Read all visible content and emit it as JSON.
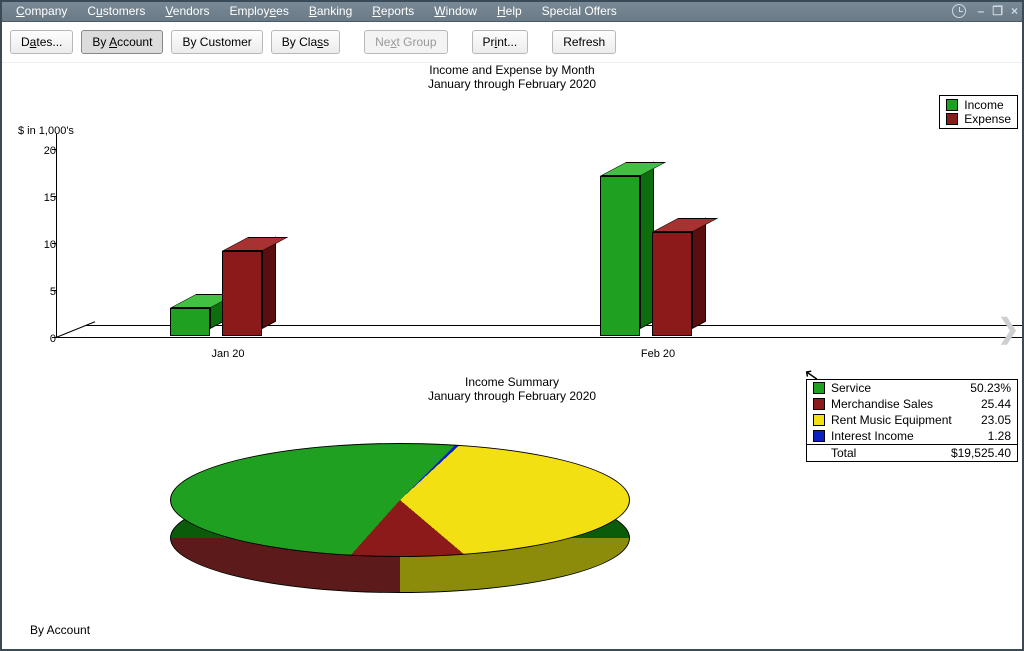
{
  "menu": {
    "items": [
      "Company",
      "Customers",
      "Vendors",
      "Employees",
      "Banking",
      "Reports",
      "Window",
      "Help",
      "Special Offers"
    ]
  },
  "window_controls": {
    "minimize": "–",
    "restore": "❐",
    "close": "×"
  },
  "toolbar": {
    "dates": "Dates...",
    "by_account": "By Account",
    "by_customer": "By Customer",
    "by_class": "By Class",
    "next_group": "Next Group",
    "print": "Print...",
    "refresh": "Refresh"
  },
  "bar_chart": {
    "title": "Income and Expense by Month",
    "subtitle": "January through February 2020",
    "axis_label": "$ in 1,000's",
    "legend": {
      "income": "Income",
      "expense": "Expense"
    },
    "y_ticks": [
      "0",
      "5",
      "10",
      "15",
      "20"
    ],
    "x_ticks": [
      "Jan 20",
      "Feb 20"
    ]
  },
  "pie": {
    "title": "Income Summary",
    "subtitle": "January through February 2020",
    "legend": [
      {
        "label": "Service",
        "value": "50.23%",
        "color": "#20a020"
      },
      {
        "label": "Merchandise Sales",
        "value": "25.44",
        "color": "#8c1a1a"
      },
      {
        "label": "Rent Music Equipment",
        "value": "23.05",
        "color": "#f2e012"
      },
      {
        "label": "Interest Income",
        "value": "1.28",
        "color": "#0a20c0"
      }
    ],
    "total_label": "Total",
    "total_value": "$19,525.40"
  },
  "footer": {
    "view_label": "By Account"
  },
  "chart_data": [
    {
      "type": "bar",
      "title": "Income and Expense by Month",
      "subtitle": "January through February 2020",
      "categories": [
        "Jan 20",
        "Feb 20"
      ],
      "series": [
        {
          "name": "Income",
          "values": [
            3,
            17
          ],
          "color": "#20a020"
        },
        {
          "name": "Expense",
          "values": [
            9,
            11
          ],
          "color": "#8c1a1a"
        }
      ],
      "ylabel": "$ in 1,000's",
      "ylim": [
        0,
        20
      ],
      "y_ticks": [
        0,
        5,
        10,
        15,
        20
      ]
    },
    {
      "type": "pie",
      "title": "Income Summary",
      "subtitle": "January through February 2020",
      "categories": [
        "Service",
        "Merchandise Sales",
        "Rent Music Equipment",
        "Interest Income"
      ],
      "values": [
        50.23,
        25.44,
        23.05,
        1.28
      ],
      "colors": [
        "#20a020",
        "#8c1a1a",
        "#f2e012",
        "#0a20c0"
      ],
      "total": 19525.4,
      "unit": "percent"
    }
  ]
}
